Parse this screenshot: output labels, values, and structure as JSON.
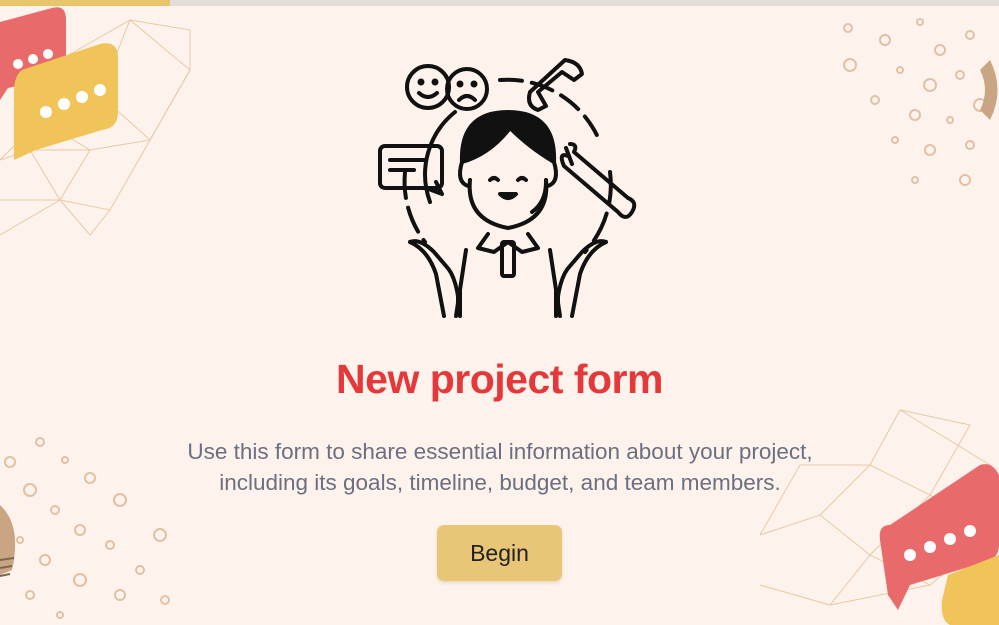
{
  "progress": {
    "fraction": 0.17
  },
  "hero": {
    "icon": "customer-support-person-icon"
  },
  "form": {
    "title": "New project form",
    "description_line1": "Use this form to share essential information about your project,",
    "description_line2": "including its goals, timeline, budget, and team members."
  },
  "actions": {
    "begin_label": "Begin"
  },
  "colors": {
    "background": "#fdf3ec",
    "title": "#e5383b",
    "description": "#6b6f80",
    "button": "#e9c677",
    "progress": "#e8c46a",
    "bubble_red": "#e86a6a",
    "bubble_yellow": "#f1c45a"
  }
}
